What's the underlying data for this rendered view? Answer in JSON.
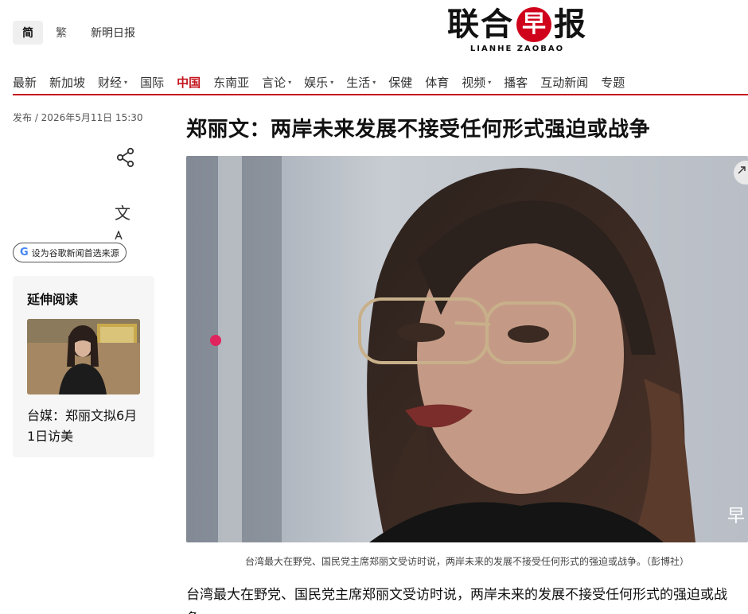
{
  "header": {
    "lang_simplified": "简",
    "lang_traditional": "繁",
    "brand_link": "新明日报",
    "logo_chars": [
      "联",
      "合",
      "早",
      "报"
    ],
    "logo_sub": "LIANHE ZAOBAO",
    "brand_color": "#d0021b"
  },
  "nav": {
    "items": [
      {
        "label": "最新",
        "dropdown": false,
        "active": false
      },
      {
        "label": "新加坡",
        "dropdown": false,
        "active": false
      },
      {
        "label": "财经",
        "dropdown": true,
        "active": false
      },
      {
        "label": "国际",
        "dropdown": false,
        "active": false
      },
      {
        "label": "中国",
        "dropdown": false,
        "active": true
      },
      {
        "label": "东南亚",
        "dropdown": false,
        "active": false
      },
      {
        "label": "言论",
        "dropdown": true,
        "active": false
      },
      {
        "label": "娱乐",
        "dropdown": true,
        "active": false
      },
      {
        "label": "生活",
        "dropdown": true,
        "active": false
      },
      {
        "label": "保健",
        "dropdown": false,
        "active": false
      },
      {
        "label": "体育",
        "dropdown": false,
        "active": false
      },
      {
        "label": "视频",
        "dropdown": true,
        "active": false
      },
      {
        "label": "播客",
        "dropdown": false,
        "active": false
      },
      {
        "label": "互动新闻",
        "dropdown": false,
        "active": false
      },
      {
        "label": "专题",
        "dropdown": false,
        "active": false
      }
    ],
    "accent_color": "#c4151c"
  },
  "article": {
    "publish": "发布 / 2026年5月11日 15:30",
    "headline": "郑丽文：两岸未来发展不接受任何形式强迫或战争",
    "caption": "台湾最大在野党、国民党主席郑丽文受访时说，两岸未来的发展不接受任何形式的强迫或战争。（彭博社）",
    "body": "台湾最大在野党、国民党主席郑丽文受访时说，两岸未来的发展不接受任何形式的强迫或战争。",
    "watermark": "早"
  },
  "sidebar": {
    "google_pill": "设为谷歌新闻首选来源",
    "google_g": "G",
    "translate_glyph": "文",
    "related_title": "延伸阅读",
    "related_link": "台媒：郑丽文拟6月1日访美"
  },
  "icons": {
    "share": "share-icon",
    "translate": "translate-icon",
    "google": "google-icon",
    "expand": "expand-icon",
    "dropdown": "chevron-down-icon"
  }
}
